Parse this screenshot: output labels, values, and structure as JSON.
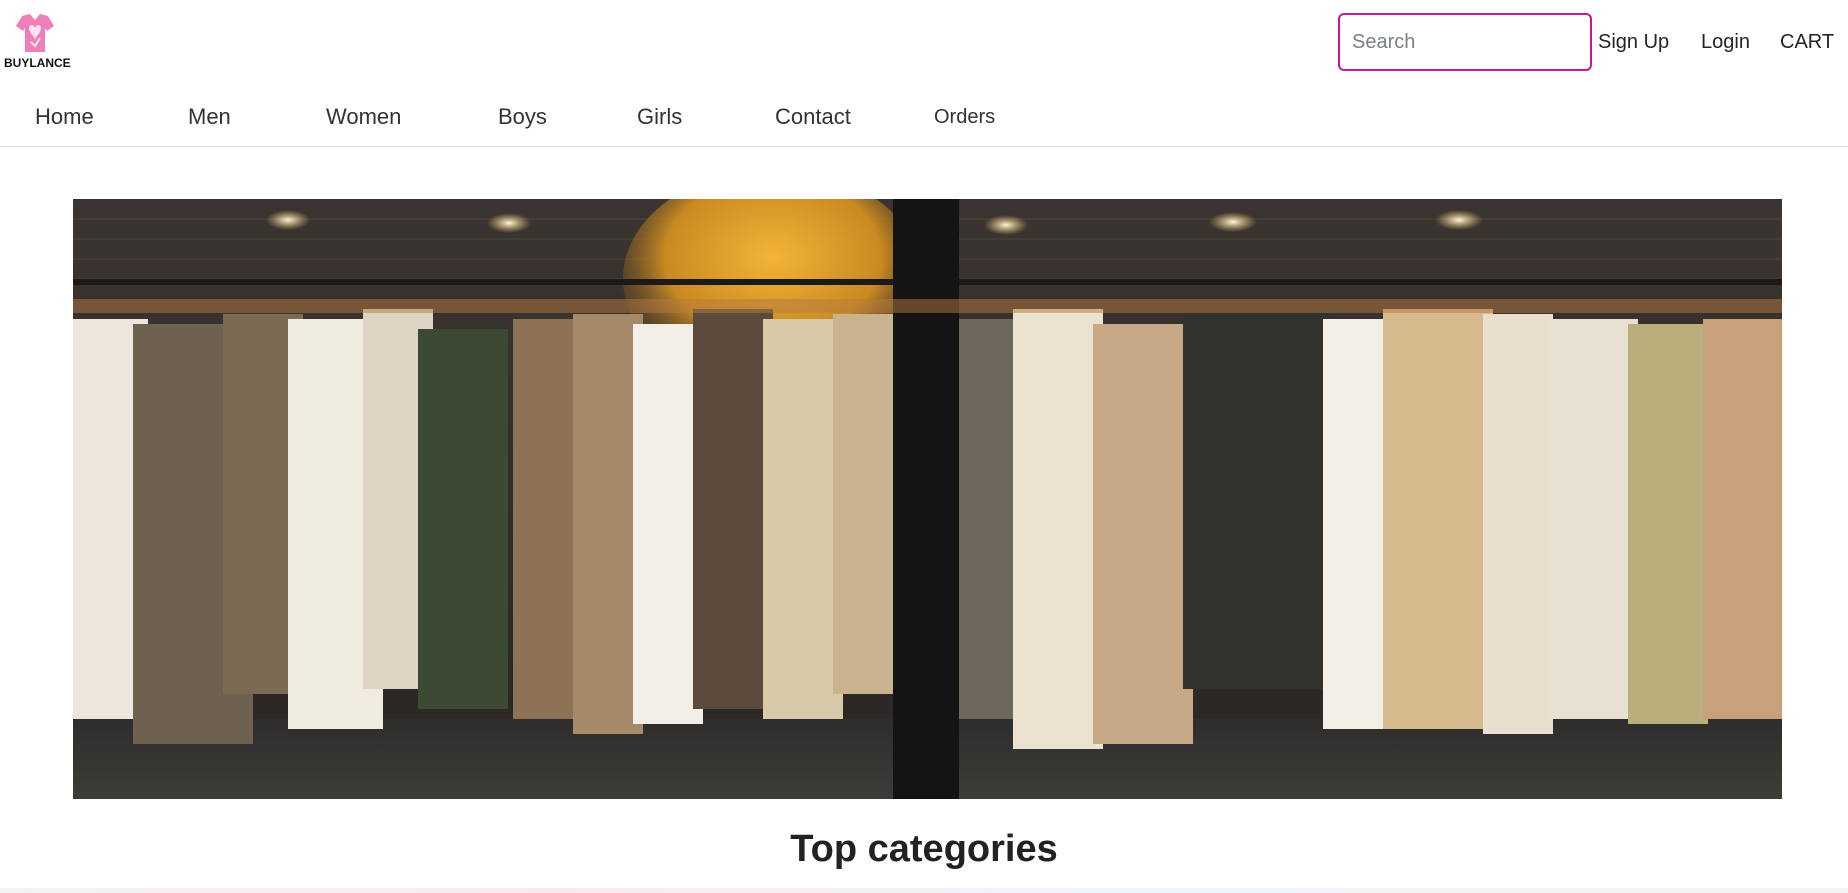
{
  "brand": {
    "name": "BUYLANCE",
    "logo_icon": "shirt-heart-icon",
    "accent": "#c21a97"
  },
  "header": {
    "search": {
      "placeholder": "Search",
      "value": ""
    },
    "links": [
      "Sign Up",
      "Login",
      "CART"
    ]
  },
  "nav": {
    "items": [
      "Home",
      "Men",
      "Women",
      "Boys",
      "Girls",
      "Contact",
      "Orders"
    ]
  },
  "hero": {
    "image": "clothing-rack-store-window"
  },
  "section": {
    "title": "Top categories"
  }
}
